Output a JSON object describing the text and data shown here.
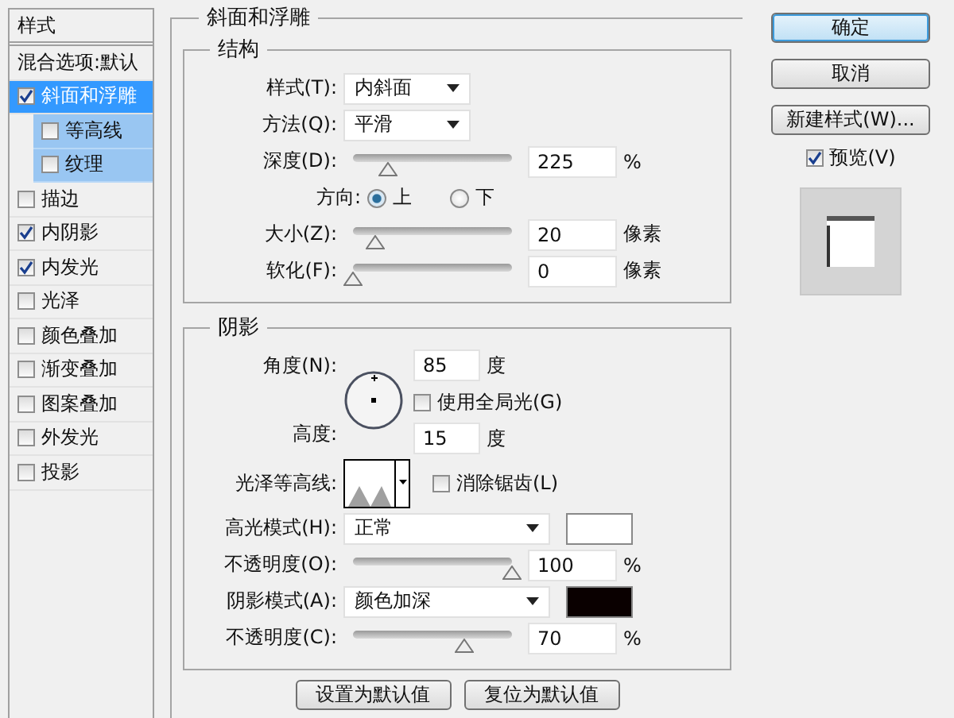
{
  "sidebar": {
    "header": "样式",
    "items": [
      {
        "kind": "plain",
        "label": "混合选项:默认",
        "selected": false
      },
      {
        "kind": "check",
        "label": "斜面和浮雕",
        "checked": true,
        "selected": true,
        "children": [
          {
            "label": "等高线",
            "checked": false,
            "selected": false
          },
          {
            "label": "纹理",
            "checked": false,
            "selected": false
          }
        ]
      },
      {
        "kind": "check",
        "label": "描边",
        "checked": false,
        "selected": false
      },
      {
        "kind": "check",
        "label": "内阴影",
        "checked": true,
        "selected": false
      },
      {
        "kind": "check",
        "label": "内发光",
        "checked": true,
        "selected": false
      },
      {
        "kind": "check",
        "label": "光泽",
        "checked": false,
        "selected": false
      },
      {
        "kind": "check",
        "label": "颜色叠加",
        "checked": false,
        "selected": false
      },
      {
        "kind": "check",
        "label": "渐变叠加",
        "checked": false,
        "selected": false
      },
      {
        "kind": "check",
        "label": "图案叠加",
        "checked": false,
        "selected": false
      },
      {
        "kind": "check",
        "label": "外发光",
        "checked": false,
        "selected": false
      },
      {
        "kind": "check",
        "label": "投影",
        "checked": false,
        "selected": false
      }
    ]
  },
  "panel": {
    "title": "斜面和浮雕",
    "structure": {
      "title": "结构",
      "rows": [
        {
          "kind": "select",
          "label": "样式(T):",
          "value": "内斜面"
        },
        {
          "kind": "select",
          "label": "方法(Q):",
          "value": "平滑"
        },
        {
          "kind": "slider",
          "label": "深度(D):",
          "level": 0.22,
          "value": "225",
          "unit": "%"
        },
        {
          "kind": "radio",
          "label": "方向:",
          "options": [
            {
              "label": "上",
              "selected": true
            },
            {
              "label": "下",
              "selected": false
            }
          ]
        },
        {
          "kind": "slider",
          "label": "大小(Z):",
          "level": 0.14,
          "value": "20",
          "unit": "像素"
        },
        {
          "kind": "slider",
          "label": "软化(F):",
          "level": 0,
          "value": "0",
          "unit": "像素"
        }
      ]
    },
    "shading": {
      "title": "阴影",
      "rows": [
        {
          "kind": "angle",
          "label": "角度(N):",
          "value": "85",
          "unit": "度",
          "global_light": {
            "label": "使用全局光(G)",
            "checked": false
          },
          "altitude_label": "高度:",
          "altitude": "15",
          "altitude_unit": "度"
        },
        {
          "kind": "contour",
          "label": "光泽等高线:",
          "anti_alias": {
            "label": "消除锯齿(L)",
            "checked": false
          }
        },
        {
          "kind": "select",
          "label": "高光模式(H):",
          "value": "正常",
          "color": "#ffffff"
        },
        {
          "kind": "slider",
          "label": "不透明度(O):",
          "level": 1,
          "value": "100",
          "unit": "%"
        },
        {
          "kind": "select",
          "label": "阴影模式(A):",
          "value": "颜色加深",
          "color": "#0a0000"
        },
        {
          "kind": "slider",
          "label": "不透明度(C):",
          "level": 0.7,
          "value": "70",
          "unit": "%"
        }
      ]
    },
    "buttons": [
      "设置为默认值",
      "复位为默认值"
    ]
  },
  "actions": [
    {
      "label": "确定",
      "kind": "default"
    },
    {
      "label": "取消",
      "kind": "normal"
    },
    {
      "label": "新建样式(W)...",
      "kind": "normal"
    }
  ],
  "preview": {
    "label": "预览(V)",
    "checked": true
  }
}
